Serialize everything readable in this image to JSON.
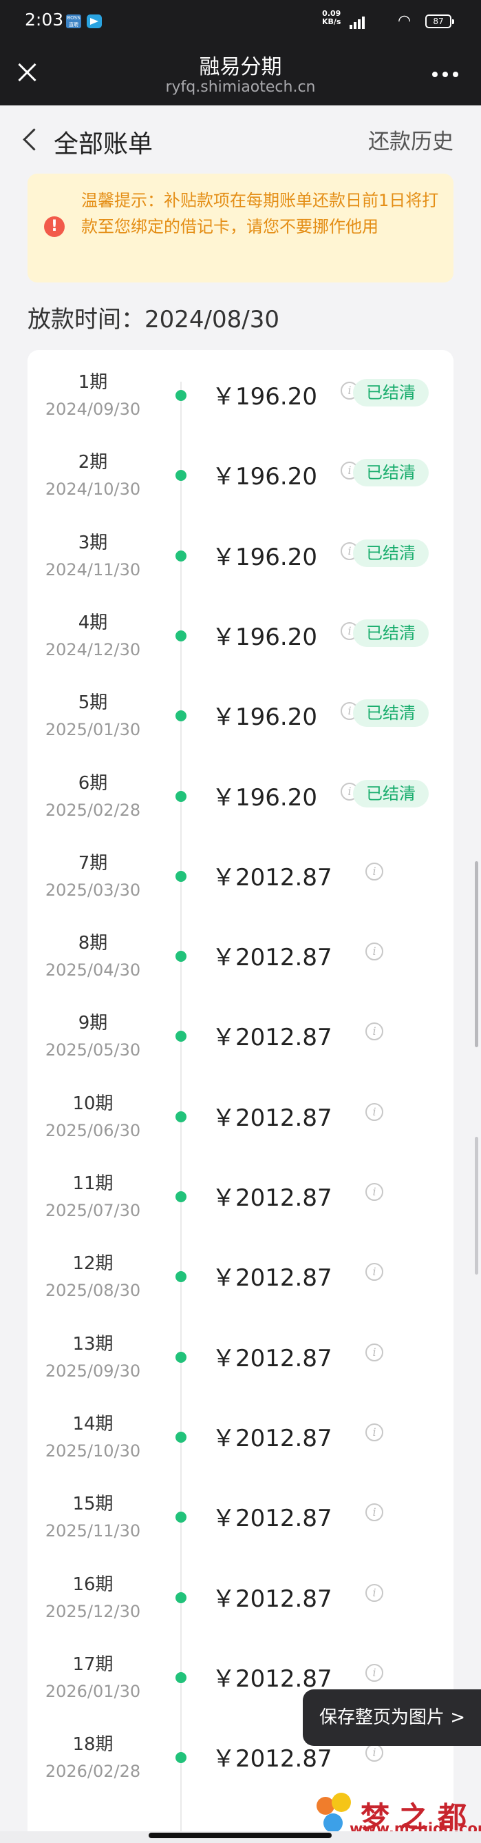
{
  "status_bar": {
    "time": "2:03",
    "app_a_label": "BOSS 直聘",
    "net_speed": "0.09",
    "net_unit": "KB/s",
    "battery": "87"
  },
  "nav": {
    "title": "融易分期",
    "subtitle": "ryfq.shimiaotech.cn"
  },
  "header": {
    "title": "全部账单",
    "history": "还款历史"
  },
  "notice": {
    "text": "温馨提示：补贴款项在每期账单还款日前1日将打款至您绑定的借记卡，请您不要挪作他用"
  },
  "loan_time": "放款时间：2024/08/30",
  "installments": [
    {
      "period": "1期",
      "date": "2024/09/30",
      "amount": "￥196.20",
      "status": "已结清"
    },
    {
      "period": "2期",
      "date": "2024/10/30",
      "amount": "￥196.20",
      "status": "已结清"
    },
    {
      "period": "3期",
      "date": "2024/11/30",
      "amount": "￥196.20",
      "status": "已结清"
    },
    {
      "period": "4期",
      "date": "2024/12/30",
      "amount": "￥196.20",
      "status": "已结清"
    },
    {
      "period": "5期",
      "date": "2025/01/30",
      "amount": "￥196.20",
      "status": "已结清"
    },
    {
      "period": "6期",
      "date": "2025/02/28",
      "amount": "￥196.20",
      "status": "已结清"
    },
    {
      "period": "7期",
      "date": "2025/03/30",
      "amount": "￥2012.87",
      "status": ""
    },
    {
      "period": "8期",
      "date": "2025/04/30",
      "amount": "￥2012.87",
      "status": ""
    },
    {
      "period": "9期",
      "date": "2025/05/30",
      "amount": "￥2012.87",
      "status": ""
    },
    {
      "period": "10期",
      "date": "2025/06/30",
      "amount": "￥2012.87",
      "status": ""
    },
    {
      "period": "11期",
      "date": "2025/07/30",
      "amount": "￥2012.87",
      "status": ""
    },
    {
      "period": "12期",
      "date": "2025/08/30",
      "amount": "￥2012.87",
      "status": ""
    },
    {
      "period": "13期",
      "date": "2025/09/30",
      "amount": "￥2012.87",
      "status": ""
    },
    {
      "period": "14期",
      "date": "2025/10/30",
      "amount": "￥2012.87",
      "status": ""
    },
    {
      "period": "15期",
      "date": "2025/11/30",
      "amount": "￥2012.87",
      "status": ""
    },
    {
      "period": "16期",
      "date": "2025/12/30",
      "amount": "￥2012.87",
      "status": ""
    },
    {
      "period": "17期",
      "date": "2026/01/30",
      "amount": "￥2012.87",
      "status": ""
    },
    {
      "period": "18期",
      "date": "2026/02/28",
      "amount": "￥2012.87",
      "status": ""
    }
  ],
  "save_button": "保存整页为图片 >",
  "watermark": {
    "name": "梦之都",
    "url": "www.mzhidu.com"
  },
  "colors": {
    "accent_green": "#21c27a",
    "notice_text": "#e48e16",
    "notice_bg": "#fff5d3",
    "notice_icon": "#f25a4a"
  }
}
